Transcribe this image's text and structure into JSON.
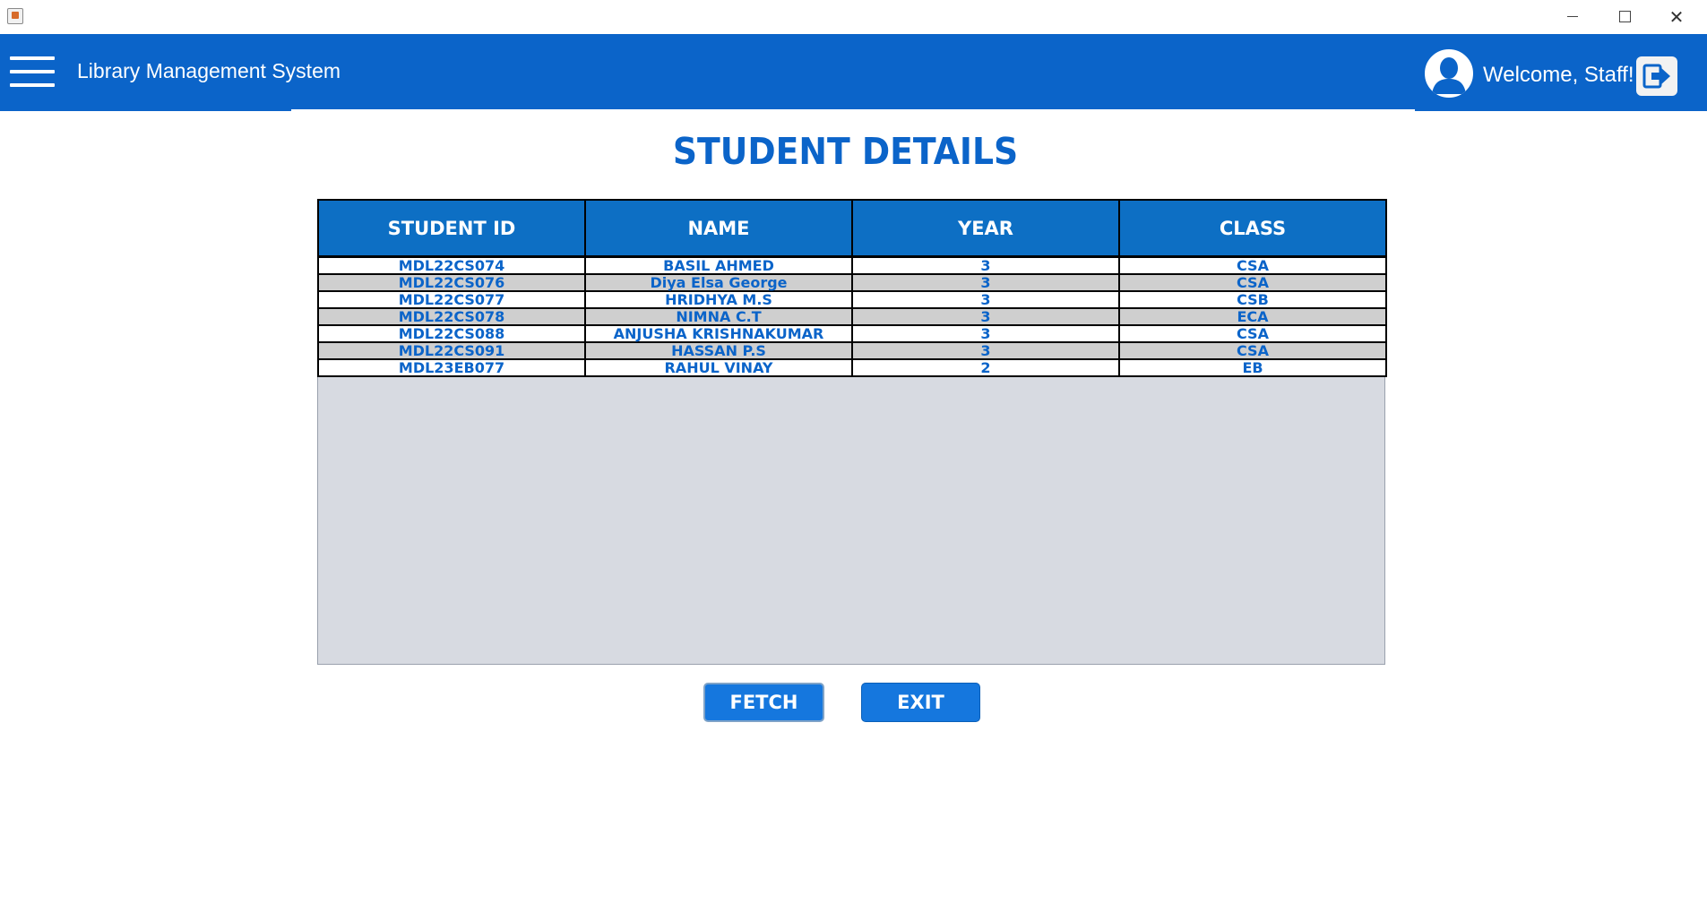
{
  "header": {
    "title": "Library Management System",
    "welcome": "Welcome, Staff!"
  },
  "page": {
    "heading": "STUDENT DETAILS"
  },
  "table": {
    "columns": [
      "STUDENT ID",
      "NAME",
      "YEAR",
      "CLASS"
    ],
    "rows": [
      [
        "MDL22CS074",
        "BASIL AHMED",
        "3",
        "CSA"
      ],
      [
        "MDL22CS076",
        "Diya Elsa George",
        "3",
        "CSA"
      ],
      [
        "MDL22CS077",
        "HRIDHYA M.S",
        "3",
        "CSB"
      ],
      [
        "MDL22CS078",
        "NIMNA C.T",
        "3",
        "ECA"
      ],
      [
        "MDL22CS088",
        "ANJUSHA KRISHNAKUMAR",
        "3",
        "CSA"
      ],
      [
        "MDL22CS091",
        "HASSAN P.S",
        "3",
        "CSA"
      ],
      [
        "MDL23EB077",
        "RAHUL VINAY",
        "2",
        "EB"
      ]
    ]
  },
  "buttons": {
    "fetch": "FETCH",
    "exit": "EXIT"
  },
  "colors": {
    "header_bg": "#0b64c9",
    "table_header_bg": "#0d6fc4",
    "button_bg": "#1577de",
    "text_accent": "#0b64c9",
    "row_alt": "#cfcfcf",
    "table_empty_bg": "#d7dae1"
  },
  "icons": {
    "menu": "hamburger-menu-icon",
    "avatar": "user-avatar-icon",
    "logout": "logout-icon",
    "app": "java-app-icon",
    "minimize": "minimize-icon",
    "maximize": "maximize-icon",
    "close": "close-icon"
  }
}
